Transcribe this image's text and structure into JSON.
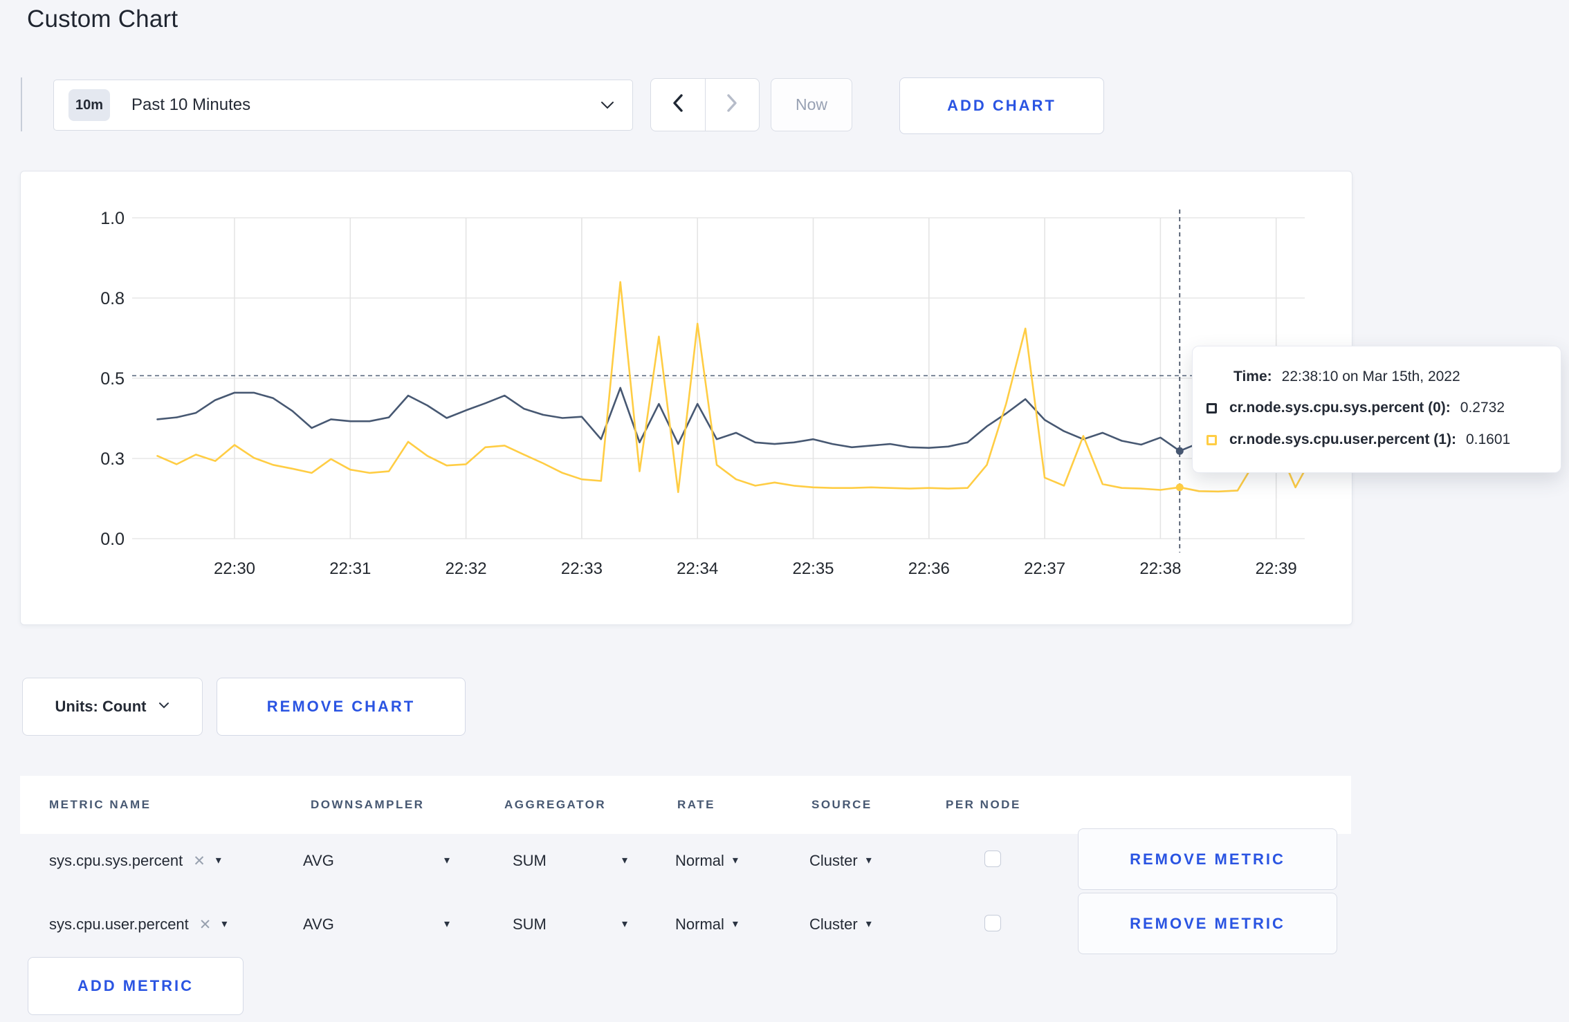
{
  "page": {
    "title": "Custom Chart"
  },
  "colors": {
    "accent_blue": "#2A54E2",
    "series_sys": "#475872",
    "series_user": "#FFCD44",
    "page_bg": "#F4F5F9"
  },
  "icons": {
    "caret_down": "▾",
    "clear_x": "✕"
  },
  "toolbar": {
    "time_range": {
      "badge": "10m",
      "label": "Past 10 Minutes"
    },
    "now_label": "Now",
    "add_chart_label": "ADD CHART"
  },
  "chart_data": {
    "type": "line",
    "title": "",
    "xlabel": "",
    "ylabel": "",
    "ylim": [
      0,
      1
    ],
    "grid": true,
    "legend_position": "tooltip-overlay",
    "x_ticks": [
      "22:30",
      "22:31",
      "22:32",
      "22:33",
      "22:34",
      "22:35",
      "22:36",
      "22:37",
      "22:38",
      "22:39"
    ],
    "y_ticks": [
      {
        "label": "0.0",
        "value": 0
      },
      {
        "label": "0.3",
        "value": 0.25
      },
      {
        "label": "0.5",
        "value": 0.5
      },
      {
        "label": "0.8",
        "value": 0.75
      },
      {
        "label": "1.0",
        "value": 1
      }
    ],
    "time_start_offset_s": -40,
    "time_step_s": 10,
    "series": [
      {
        "name": "cr.node.sys.cpu.sys.percent (0)",
        "color": "#475872",
        "values": [
          0.372,
          0.378,
          0.392,
          0.432,
          0.455,
          0.455,
          0.438,
          0.398,
          0.345,
          0.372,
          0.366,
          0.366,
          0.378,
          0.446,
          0.415,
          0.376,
          0.4,
          0.422,
          0.446,
          0.405,
          0.386,
          0.376,
          0.38,
          0.31,
          0.47,
          0.3,
          0.42,
          0.295,
          0.42,
          0.31,
          0.33,
          0.3,
          0.295,
          0.3,
          0.31,
          0.295,
          0.285,
          0.29,
          0.295,
          0.285,
          0.283,
          0.287,
          0.3,
          0.35,
          0.39,
          0.435,
          0.37,
          0.335,
          0.31,
          0.33,
          0.305,
          0.293,
          0.315,
          0.2732,
          0.298,
          0.305,
          0.298,
          0.3,
          0.312,
          0.303,
          0.268
        ]
      },
      {
        "name": "cr.node.sys.cpu.user.percent (1)",
        "color": "#FFCD44",
        "values": [
          0.258,
          0.232,
          0.262,
          0.242,
          0.292,
          0.252,
          0.23,
          0.218,
          0.205,
          0.248,
          0.215,
          0.205,
          0.21,
          0.302,
          0.258,
          0.228,
          0.232,
          0.285,
          0.29,
          0.262,
          0.235,
          0.205,
          0.185,
          0.18,
          0.8,
          0.21,
          0.63,
          0.145,
          0.67,
          0.23,
          0.185,
          0.165,
          0.175,
          0.165,
          0.16,
          0.158,
          0.158,
          0.16,
          0.158,
          0.156,
          0.158,
          0.156,
          0.158,
          0.23,
          0.42,
          0.655,
          0.19,
          0.165,
          0.32,
          0.17,
          0.158,
          0.156,
          0.152,
          0.1601,
          0.148,
          0.147,
          0.15,
          0.25,
          0.3,
          0.16,
          0.27
        ]
      }
    ],
    "guideline_value": 0.508,
    "crosshair": {
      "offset_s": 490,
      "time_label": "22:38:10",
      "sys_value": 0.2732,
      "user_value": 0.1601
    }
  },
  "tooltip": {
    "time_label": "Time:",
    "time_value": "22:38:10 on Mar 15th, 2022",
    "rows": [
      {
        "name": "cr.node.sys.cpu.sys.percent (0):",
        "value": "0.2732",
        "swatch_color": "#242A35"
      },
      {
        "name": "cr.node.sys.cpu.user.percent (1):",
        "value": "0.1601",
        "swatch_color": "#FFCD44"
      }
    ]
  },
  "units_row": {
    "units_label": "Units: Count",
    "remove_chart_label": "REMOVE CHART"
  },
  "metrics_table": {
    "columns": [
      "METRIC NAME",
      "DOWNSAMPLER",
      "AGGREGATOR",
      "RATE",
      "SOURCE",
      "PER NODE"
    ],
    "rows": [
      {
        "metric": "sys.cpu.sys.percent",
        "downsampler": "AVG",
        "aggregator": "SUM",
        "rate": "Normal",
        "source": "Cluster",
        "per_node_checked": false,
        "remove_label": "REMOVE METRIC"
      },
      {
        "metric": "sys.cpu.user.percent",
        "downsampler": "AVG",
        "aggregator": "SUM",
        "rate": "Normal",
        "source": "Cluster",
        "per_node_checked": false,
        "remove_label": "REMOVE METRIC"
      }
    ],
    "add_metric_label": "ADD METRIC"
  }
}
